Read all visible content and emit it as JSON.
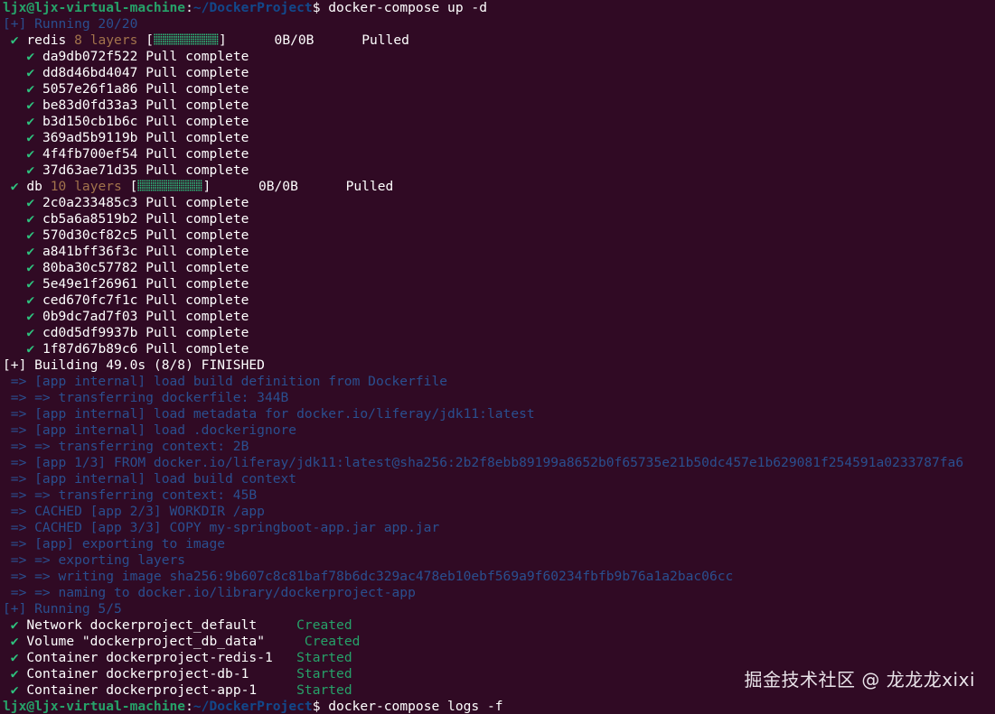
{
  "colors": {
    "background": "#300a24",
    "prompt_user": "#26a269",
    "prompt_path": "#12488b",
    "check": "#2ec27e",
    "dim_blue": "#2a4f8f",
    "layers_count": "#a2734c"
  },
  "prompt": {
    "user_host": "ljx@ljx-virtual-machine",
    "colon": ":",
    "path": "~/DockerProject",
    "dollar": "$ "
  },
  "first_command": "docker-compose up -d",
  "running_pull": "[+] Running 20/20",
  "services": [
    {
      "name": "redis",
      "layers_label": "8 layers",
      "size": "0B/0B",
      "status": "Pulled",
      "layers": [
        {
          "id": "da9db072f522",
          "status": "Pull complete"
        },
        {
          "id": "dd8d46bd4047",
          "status": "Pull complete"
        },
        {
          "id": "5057e26f1a86",
          "status": "Pull complete"
        },
        {
          "id": "be83d0fd33a3",
          "status": "Pull complete"
        },
        {
          "id": "b3d150cb1b6c",
          "status": "Pull complete"
        },
        {
          "id": "369ad5b9119b",
          "status": "Pull complete"
        },
        {
          "id": "4f4fb700ef54",
          "status": "Pull complete"
        },
        {
          "id": "37d63ae71d35",
          "status": "Pull complete"
        }
      ]
    },
    {
      "name": "db",
      "layers_label": "10 layers",
      "size": "0B/0B",
      "status": "Pulled",
      "layers": [
        {
          "id": "2c0a233485c3",
          "status": "Pull complete"
        },
        {
          "id": "cb5a6a8519b2",
          "status": "Pull complete"
        },
        {
          "id": "570d30cf82c5",
          "status": "Pull complete"
        },
        {
          "id": "a841bff36f3c",
          "status": "Pull complete"
        },
        {
          "id": "80ba30c57782",
          "status": "Pull complete"
        },
        {
          "id": "5e49e1f26961",
          "status": "Pull complete"
        },
        {
          "id": "ced670fc7f1c",
          "status": "Pull complete"
        },
        {
          "id": "0b9dc7ad7f03",
          "status": "Pull complete"
        },
        {
          "id": "cd0d5df9937b",
          "status": "Pull complete"
        },
        {
          "id": "1f87d67b89c6",
          "status": "Pull complete"
        }
      ]
    }
  ],
  "building_line": "[+] Building 49.0s (8/8) FINISHED",
  "build_steps": [
    " => [app internal] load build definition from Dockerfile",
    " => => transferring dockerfile: 344B",
    " => [app internal] load metadata for docker.io/liferay/jdk11:latest",
    " => [app internal] load .dockerignore",
    " => => transferring context: 2B",
    " => [app 1/3] FROM docker.io/liferay/jdk11:latest@sha256:2b2f8ebb89199a8652b0f65735e21b50dc457e1b629081f254591a0233787fa6",
    " => [app internal] load build context",
    " => => transferring context: 45B",
    " => CACHED [app 2/3] WORKDIR /app",
    " => CACHED [app 3/3] COPY my-springboot-app.jar app.jar",
    " => [app] exporting to image",
    " => => exporting layers",
    " => => writing image sha256:9b607c8c81baf78b6dc329ac478eb10ebf569a9f60234fbfb9b76a1a2bac06cc",
    " => => naming to docker.io/library/dockerproject-app"
  ],
  "running_up": "[+] Running 5/5",
  "resources": [
    {
      "label": "Network dockerproject_default  ",
      "status": "Created"
    },
    {
      "label": "Volume \"dockerproject_db_data\"  ",
      "status": "Created"
    },
    {
      "label": "Container dockerproject-redis-1",
      "status": "Started"
    },
    {
      "label": "Container dockerproject-db-1   ",
      "status": "Started"
    },
    {
      "label": "Container dockerproject-app-1  ",
      "status": "Started"
    }
  ],
  "last_command": "docker-compose logs -f",
  "watermark": "掘金技术社区 @ 龙龙龙xixi"
}
